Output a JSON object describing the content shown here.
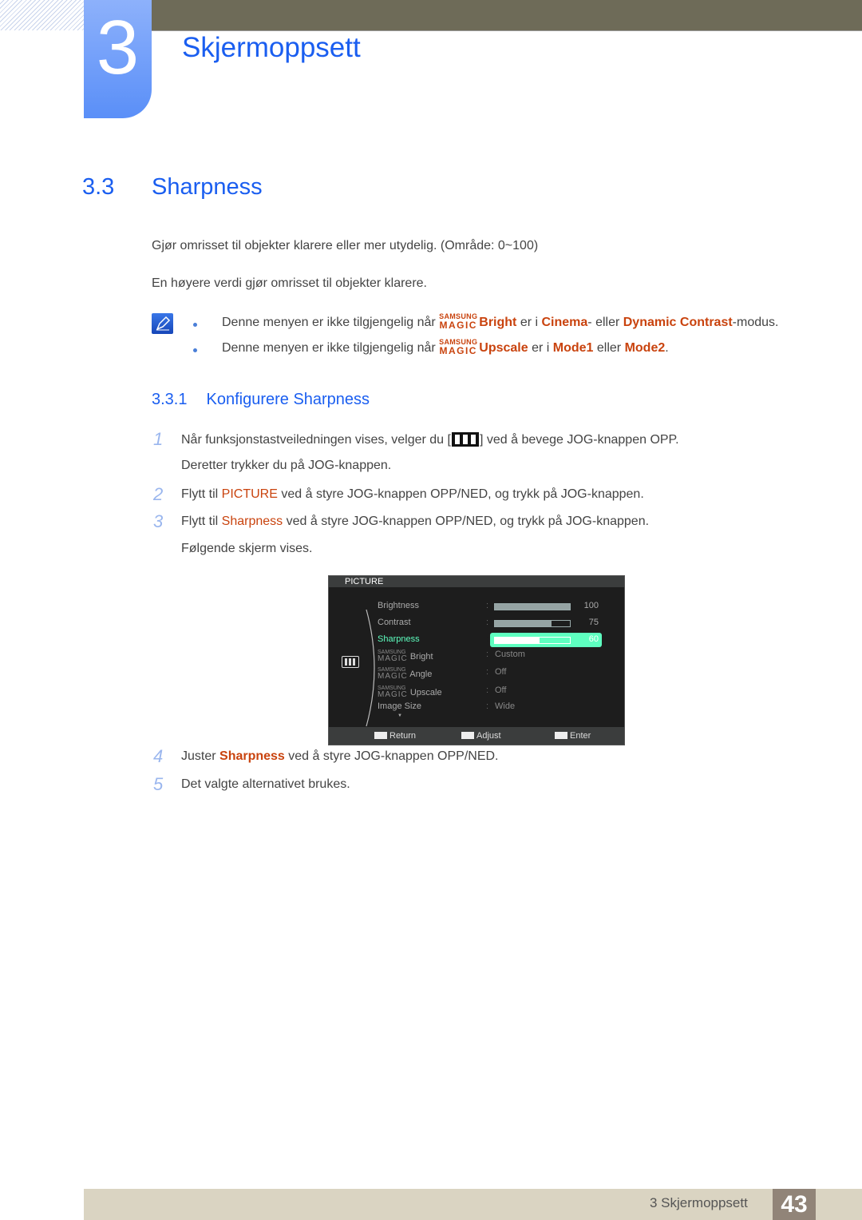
{
  "header": {
    "chapter_number": "3",
    "chapter_title": "Skjermoppsett"
  },
  "section": {
    "number": "3.3",
    "title": "Sharpness",
    "paragraphs": [
      "Gjør omrisset til objekter klarere eller mer utydelig. (Område: 0~100)",
      "En høyere verdi gjør omrisset til objekter klarere."
    ]
  },
  "notes": {
    "icon": "note-pencil-icon",
    "magic_top": "SAMSUNG",
    "magic_bottom": "MAGIC",
    "items": [
      {
        "prefix": "Denne menyen er ikke tilgjengelig når ",
        "feature": "Bright",
        "mid1": " er i ",
        "hl1": "Cinema",
        "mid2": "- eller ",
        "hl2": "Dynamic Contrast",
        "suffix": "-modus."
      },
      {
        "prefix": "Denne menyen er ikke tilgjengelig når ",
        "feature": "Upscale",
        "mid1": " er i ",
        "hl1": "Mode1",
        "mid2": " eller ",
        "hl2": "Mode2",
        "suffix": "."
      }
    ]
  },
  "subsection": {
    "number": "3.3.1",
    "title": "Konfigurere Sharpness"
  },
  "steps": [
    {
      "num": "1",
      "pre": "Når funksjonstastveiledningen vises, velger du [",
      "post": "] ved å bevege JOG-knappen OPP.",
      "line2": "Deretter trykker du på JOG-knappen."
    },
    {
      "num": "2",
      "pre": "Flytt til ",
      "hl": "PICTURE",
      "post": " ved å styre JOG-knappen OPP/NED, og trykk på JOG-knappen."
    },
    {
      "num": "3",
      "pre": "Flytt til ",
      "hl": "Sharpness",
      "post": " ved å styre JOG-knappen OPP/NED, og trykk på JOG-knappen.",
      "line2": "Følgende skjerm vises."
    },
    {
      "num": "4",
      "pre": "Juster ",
      "hl": "Sharpness",
      "post": " ved å styre JOG-knappen OPP/NED."
    },
    {
      "num": "5",
      "pre": "Det valgte alternativet brukes."
    }
  ],
  "osd": {
    "title": "PICTURE",
    "items": [
      {
        "label": "Brightness",
        "value": "100",
        "level": 100
      },
      {
        "label": "Contrast",
        "value": "75",
        "level": 75
      },
      {
        "label": "Sharpness",
        "value": "60",
        "level": 60,
        "selected": true
      },
      {
        "magic": true,
        "label": "Bright",
        "value": "Custom"
      },
      {
        "magic": true,
        "label": "Angle",
        "value": "Off"
      },
      {
        "magic": true,
        "label": "Upscale",
        "value": "Off"
      },
      {
        "label": "Image Size",
        "value": "Wide"
      }
    ],
    "separator": ":",
    "more_arrow": "▼",
    "footer": {
      "return": "Return",
      "adjust": "Adjust",
      "enter": "Enter"
    },
    "colors": {
      "selected": "#5effc0",
      "bar": "#95a3a3"
    }
  },
  "footer": {
    "chapter_label": "3 Skjermoppsett",
    "page_number": "43"
  }
}
